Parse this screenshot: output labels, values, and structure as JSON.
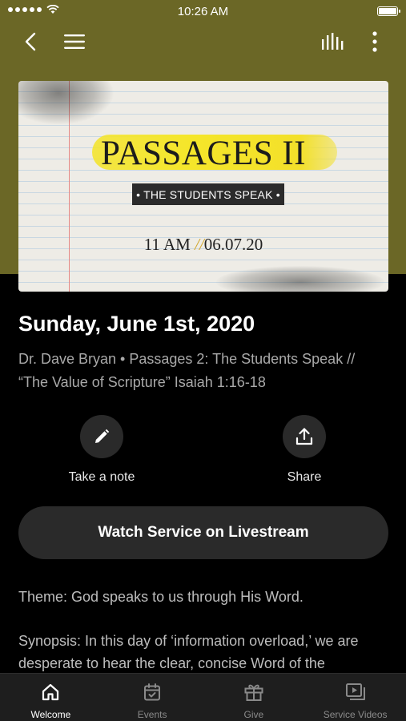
{
  "status_bar": {
    "time": "10:26 AM"
  },
  "header": {
    "icons": [
      "back-icon",
      "menu-icon",
      "audio-bars-icon",
      "more-vertical-icon"
    ],
    "band_color": "#6b6726"
  },
  "artwork": {
    "title": "PASSAGES II",
    "subtitle": "• THE STUDENTS SPEAK •",
    "time": "11 AM",
    "separator": "//",
    "date": "06.07.20",
    "highlight_color": "#f5e62a"
  },
  "content": {
    "date_heading": "Sunday, June 1st, 2020",
    "description": "Dr. Dave Bryan • Passages 2: The Students Speak  //  “The Value of Scripture” Isaiah 1:16-18",
    "actions": [
      {
        "label": "Take a note",
        "icon": "pencil-icon"
      },
      {
        "label": "Share",
        "icon": "share-icon"
      }
    ],
    "livestream_button": "Watch Service on Livestream",
    "theme": "Theme: God speaks to us through His Word.",
    "synopsis": "Synopsis:  In this day of ‘information overload,’ we are desperate to hear the clear, concise Word of the"
  },
  "tabs": [
    {
      "label": "Welcome",
      "icon": "home-icon",
      "active": true
    },
    {
      "label": "Events",
      "icon": "calendar-icon",
      "active": false
    },
    {
      "label": "Give",
      "icon": "gift-icon",
      "active": false
    },
    {
      "label": "Service Videos",
      "icon": "video-library-icon",
      "active": false
    }
  ]
}
